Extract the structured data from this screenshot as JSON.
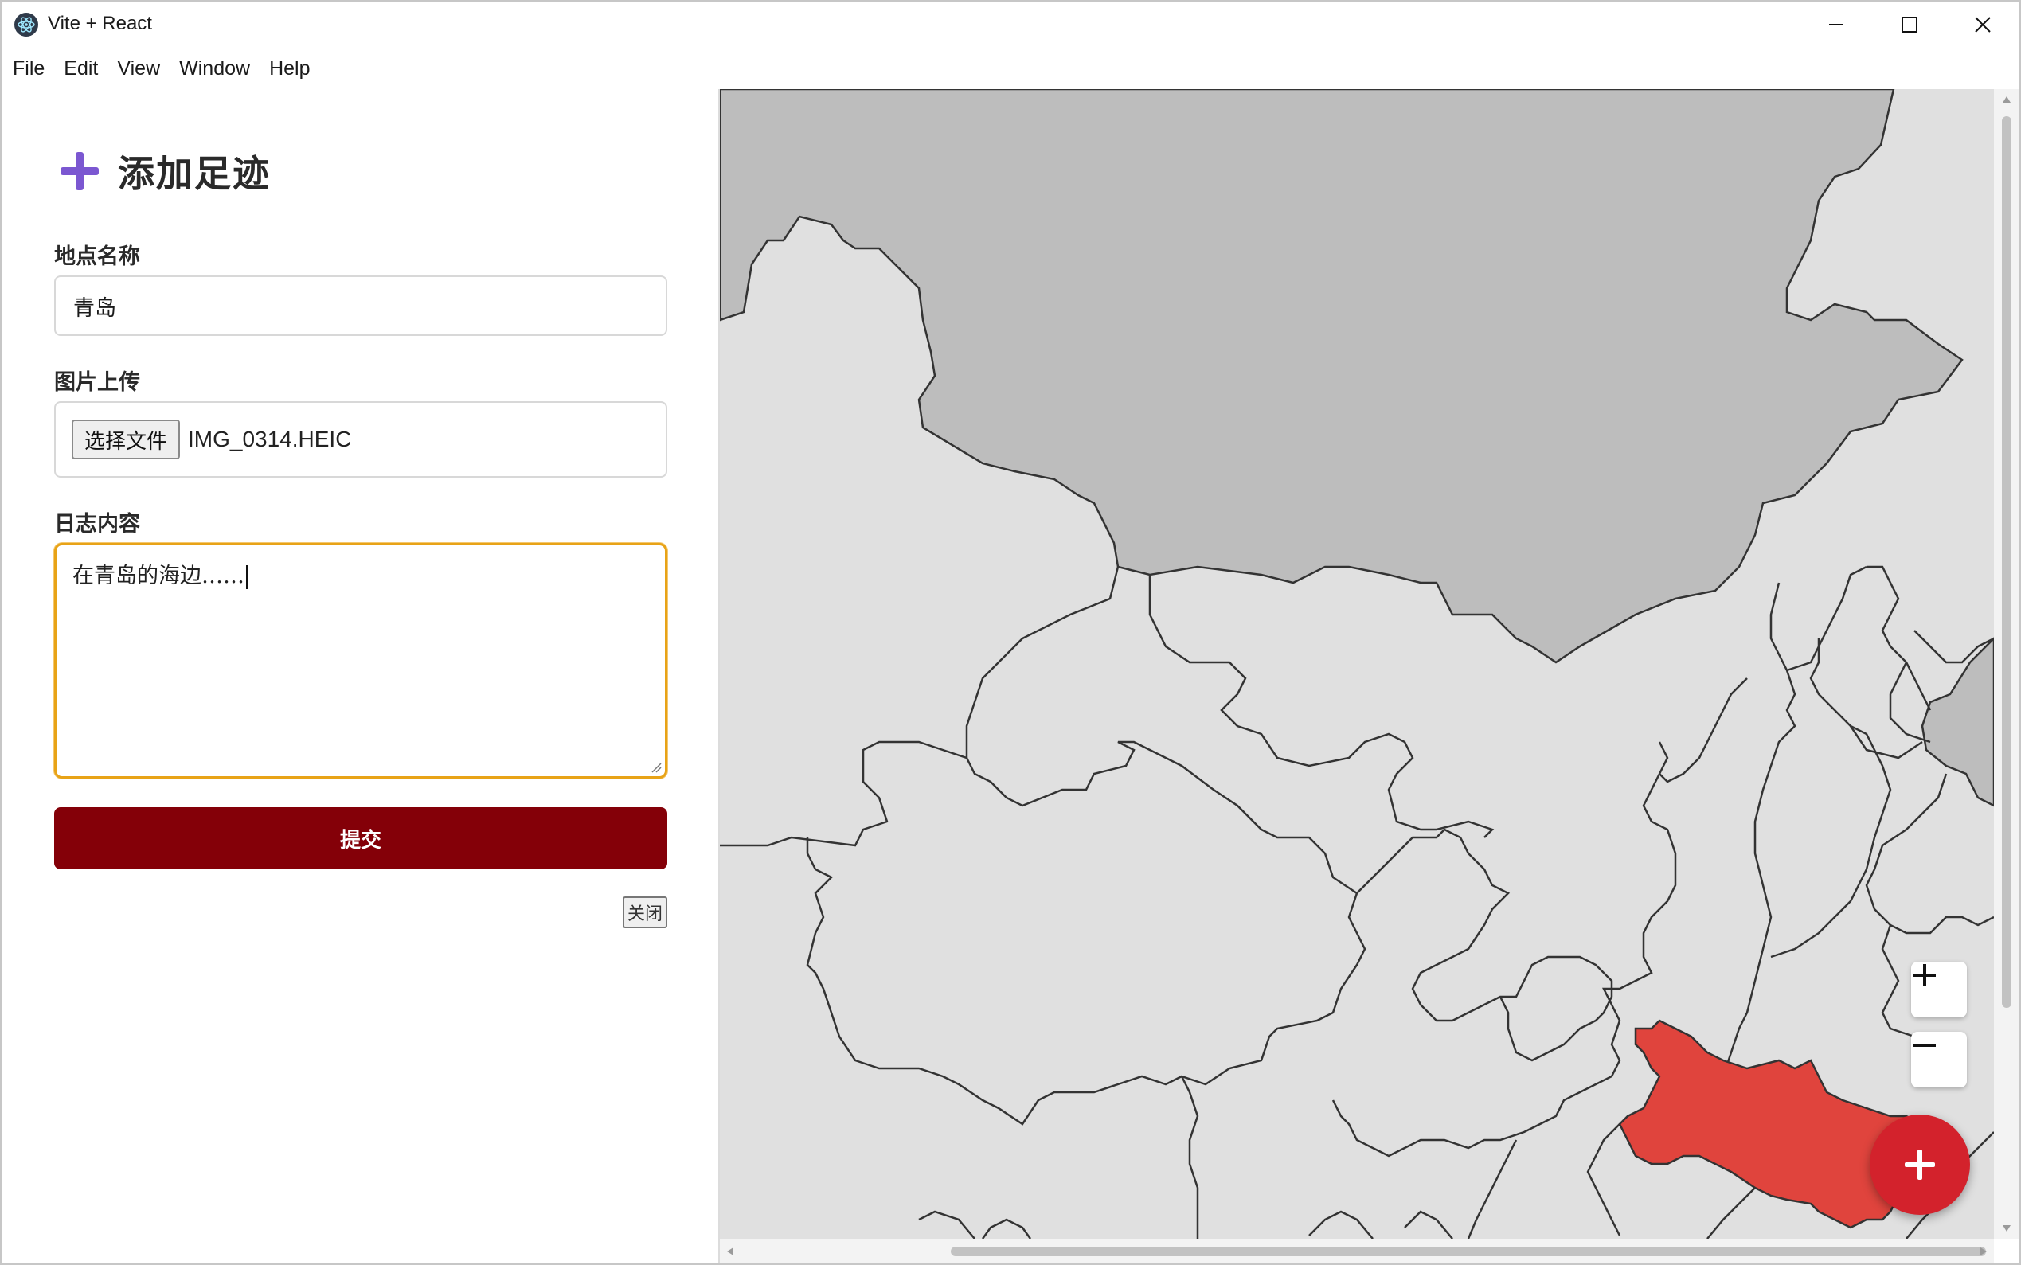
{
  "window": {
    "title": "Vite + React",
    "app_icon": "electron-icon",
    "controls": [
      "minimize-icon",
      "maximize-icon",
      "close-icon"
    ]
  },
  "menu": {
    "items": [
      "File",
      "Edit",
      "View",
      "Window",
      "Help"
    ]
  },
  "form": {
    "title": "添加足迹",
    "title_icon": "plus-icon",
    "accent_color": "#7b57d1",
    "location_label": "地点名称",
    "location_value": "青岛",
    "image_label": "图片上传",
    "file_button_label": "选择文件",
    "file_name": "IMG_0314.HEIC",
    "journal_label": "日志内容",
    "journal_value": "在青岛的海边……",
    "submit_label": "提交",
    "submit_color": "#840008",
    "close_label": "关闭"
  },
  "map": {
    "highlighted_region_color": "#e0443d",
    "region_color": "#e0e0e0",
    "water_color": "#bdbdbd",
    "zoom_in": "plus-icon",
    "zoom_out": "minus-icon",
    "fab_icon": "plus-icon",
    "fab_color": "#d3222c"
  }
}
